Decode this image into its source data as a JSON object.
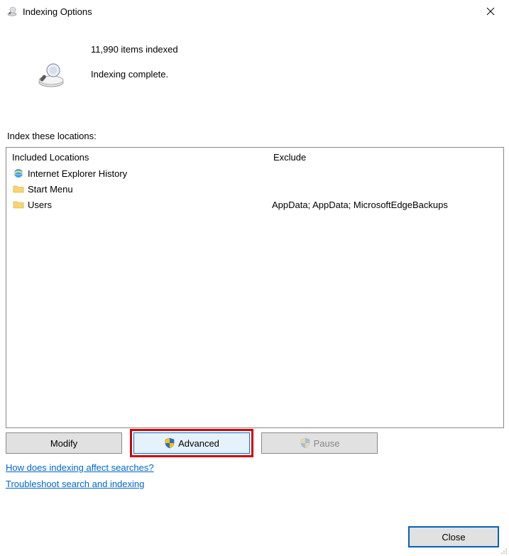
{
  "titlebar": {
    "title": "Indexing Options"
  },
  "status": {
    "items_indexed": "11,990 items indexed",
    "state": "Indexing complete."
  },
  "locations": {
    "label": "Index these locations:",
    "header_included": "Included Locations",
    "header_exclude": "Exclude",
    "rows": [
      {
        "icon": "ie-icon",
        "label": "Internet Explorer History",
        "exclude": ""
      },
      {
        "icon": "folder-icon",
        "label": "Start Menu",
        "exclude": ""
      },
      {
        "icon": "folder-icon",
        "label": "Users",
        "exclude": "AppData; AppData; MicrosoftEdgeBackups"
      }
    ]
  },
  "buttons": {
    "modify": "Modify",
    "advanced": "Advanced",
    "pause": "Pause",
    "close": "Close"
  },
  "links": {
    "how": "How does indexing affect searches?",
    "troubleshoot": "Troubleshoot search and indexing"
  }
}
